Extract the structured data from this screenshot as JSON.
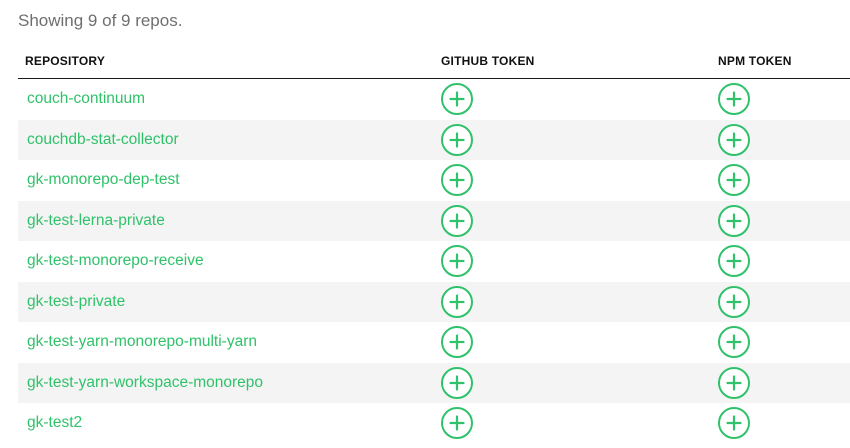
{
  "summary": "Showing 9 of 9 repos.",
  "colors": {
    "accent": "#2fc26a",
    "stripe": "#f4f4f4"
  },
  "table": {
    "headers": {
      "repository": "REPOSITORY",
      "github_token": "GITHUB TOKEN",
      "npm_token": "NPM TOKEN"
    },
    "add_icon": "plus-circle-icon",
    "rows": [
      {
        "name": "couch-continuum"
      },
      {
        "name": "couchdb-stat-collector"
      },
      {
        "name": "gk-monorepo-dep-test"
      },
      {
        "name": "gk-test-lerna-private"
      },
      {
        "name": "gk-test-monorepo-receive"
      },
      {
        "name": "gk-test-private"
      },
      {
        "name": "gk-test-yarn-monorepo-multi-yarn"
      },
      {
        "name": "gk-test-yarn-workspace-monorepo"
      },
      {
        "name": "gk-test2"
      }
    ]
  }
}
